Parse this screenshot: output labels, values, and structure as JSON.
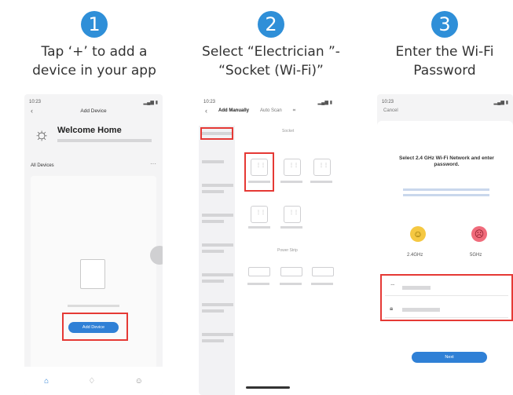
{
  "steps": [
    {
      "number": "1",
      "line1": "Tap ‘+’ to add a",
      "line2": "device in your app"
    },
    {
      "number": "2",
      "line1": "Select “Electrician ”-",
      "line2": "“Socket (Wi-Fi)”"
    },
    {
      "number": "3",
      "line1": "Enter the Wi-Fi",
      "line2": "Password"
    }
  ],
  "phone1": {
    "time": "10:23",
    "nav_title": "Add Device",
    "welcome": "Welcome Home",
    "all_devices": "All Devices",
    "add_button": "Add Device",
    "icons": [
      "back-icon",
      "sun-icon",
      "more-icon",
      "home-icon",
      "scene-icon",
      "profile-icon"
    ]
  },
  "phone2": {
    "time": "10:23",
    "tab_manual": "Add Manually",
    "tab_auto": "Auto Scan",
    "section_socket": "Socket",
    "section_power": "Power Strip"
  },
  "phone3": {
    "time": "10:23",
    "cancel": "Cancel",
    "title": "Select 2.4 GHz Wi-Fi Network and enter password.",
    "band_24": "2.4GHz",
    "band_5": "5GHz",
    "next_button": "Next"
  },
  "colors": {
    "accent": "#2f8fd8",
    "highlight": "#e53935"
  }
}
